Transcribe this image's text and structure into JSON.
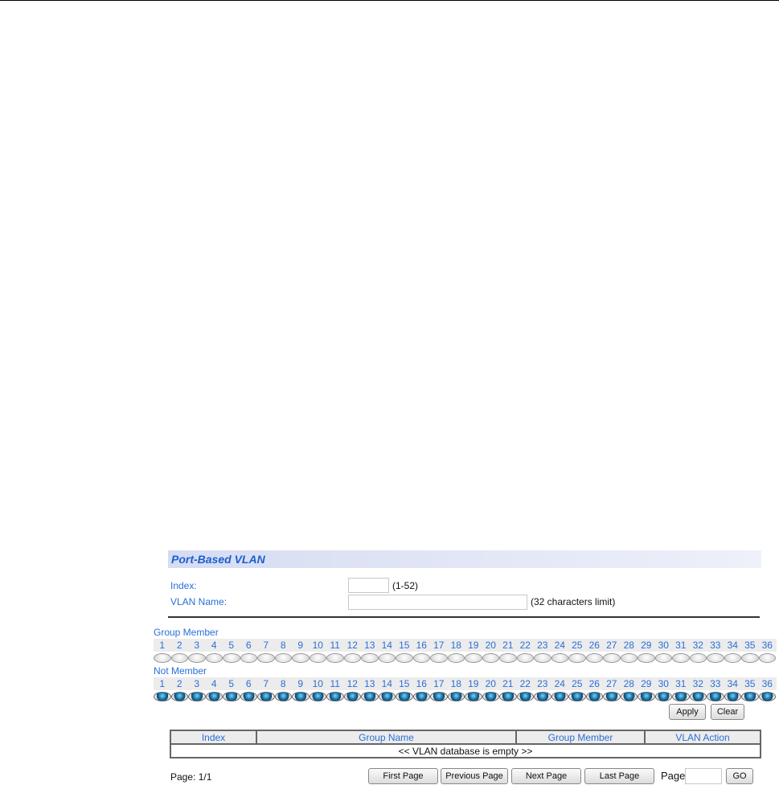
{
  "title": "Port-Based VLAN",
  "form": {
    "index_label": "Index:",
    "index_value": "",
    "index_hint": "(1-52)",
    "name_label": "VLAN Name:",
    "name_value": "",
    "name_hint": "(32 characters limit)"
  },
  "group_member_label": "Group Member",
  "not_member_label": "Not Member",
  "ports": [
    "1",
    "2",
    "3",
    "4",
    "5",
    "6",
    "7",
    "8",
    "9",
    "10",
    "11",
    "12",
    "13",
    "14",
    "15",
    "16",
    "17",
    "18",
    "19",
    "20",
    "21",
    "22",
    "23",
    "24",
    "25",
    "26",
    "27",
    "28",
    "29",
    "30",
    "31",
    "32",
    "33",
    "34",
    "35",
    "36"
  ],
  "selection": "not_member",
  "buttons": {
    "apply": "Apply",
    "clear": "Clear"
  },
  "table": {
    "headers": [
      "Index",
      "Group Name",
      "Group Member",
      "VLAN Action"
    ],
    "empty": "<< VLAN database is empty >>"
  },
  "pager": {
    "page_text": "Page:  1/1",
    "first": "First Page",
    "previous": "Previous Page",
    "next": "Next Page",
    "last": "Last Page",
    "page_label": "Page",
    "page_value": "",
    "go": "GO"
  }
}
